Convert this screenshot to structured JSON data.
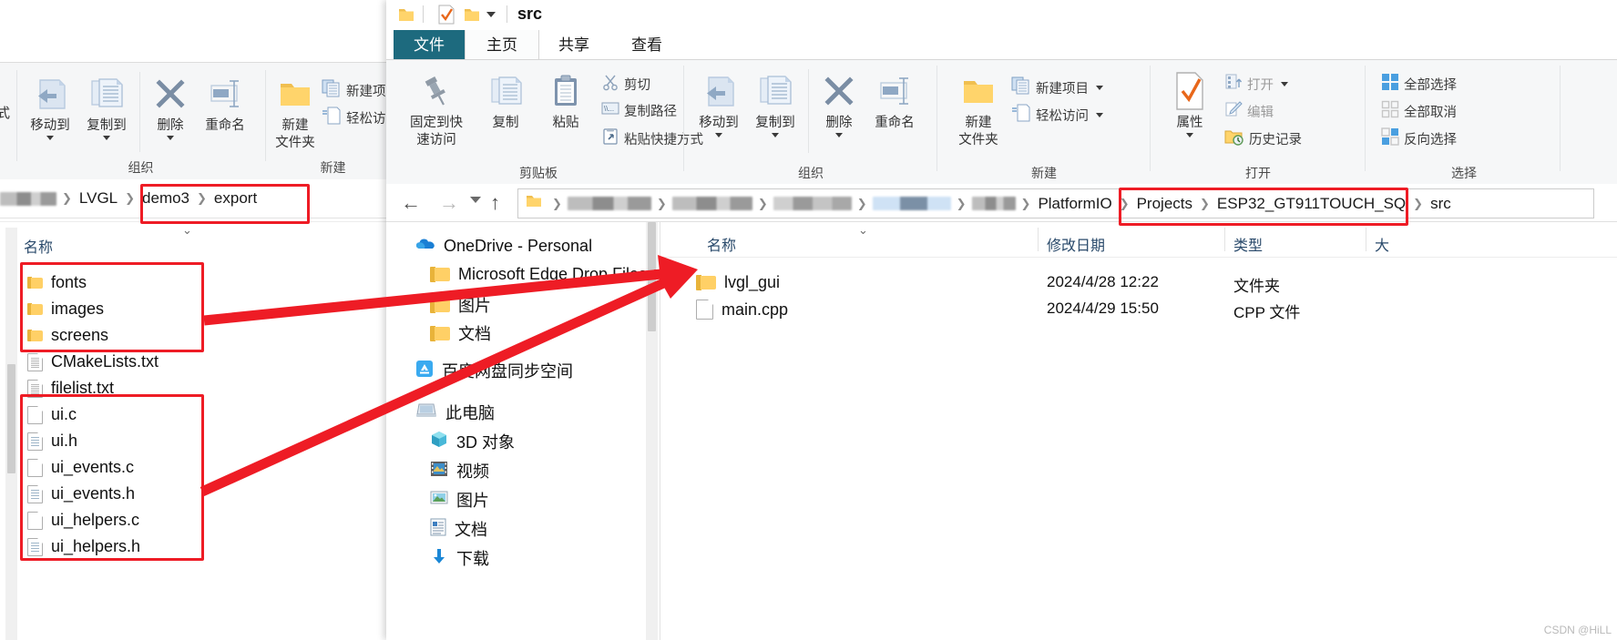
{
  "left_window": {
    "ribbon": {
      "groups": [
        {
          "label": "组织",
          "buttons": [
            {
              "label": "移动到",
              "icon": "move-to-icon",
              "has_dropdown": true
            },
            {
              "label": "复制到",
              "icon": "copy-to-icon",
              "has_dropdown": true
            },
            {
              "label": "删除",
              "icon": "delete-x-icon",
              "has_dropdown": true
            },
            {
              "label": "重命名",
              "icon": "rename-icon",
              "has_dropdown": false
            }
          ]
        },
        {
          "label": "新建",
          "buttons": [
            {
              "label": "新建\n文件夹",
              "line1": "新建",
              "line2": "文件夹",
              "icon": "new-folder-icon"
            }
          ],
          "small_buttons": [
            {
              "label": "新建项目",
              "icon": "new-item-icon",
              "has_dropdown": true
            },
            {
              "label": "轻松访问",
              "icon": "easy-access-icon",
              "has_dropdown": true
            }
          ]
        }
      ],
      "partial_left_label": "式"
    },
    "breadcrumb": {
      "redacted_prefix": true,
      "items": [
        "LVGL",
        "demo3",
        "export"
      ],
      "highlighted_from": 1
    },
    "column_header": "名称",
    "files": [
      {
        "name": "fonts",
        "icon": "folder-icon",
        "type": "folder"
      },
      {
        "name": "images",
        "icon": "folder-icon",
        "type": "folder"
      },
      {
        "name": "screens",
        "icon": "folder-icon",
        "type": "folder"
      },
      {
        "name": "CMakeLists.txt",
        "icon": "text-file-icon",
        "type": "file"
      },
      {
        "name": "filelist.txt",
        "icon": "text-file-icon",
        "type": "file"
      },
      {
        "name": "ui.c",
        "icon": "c-file-icon",
        "type": "file"
      },
      {
        "name": "ui.h",
        "icon": "h-file-icon",
        "type": "file"
      },
      {
        "name": "ui_events.c",
        "icon": "c-file-icon",
        "type": "file"
      },
      {
        "name": "ui_events.h",
        "icon": "h-file-icon",
        "type": "file"
      },
      {
        "name": "ui_helpers.c",
        "icon": "c-file-icon",
        "type": "file"
      },
      {
        "name": "ui_helpers.h",
        "icon": "h-file-icon",
        "type": "file"
      }
    ]
  },
  "right_window": {
    "title": "src",
    "titlebar_icons": [
      "folder-icon",
      "properties-check-icon",
      "new-folder-icon",
      "quick-access-dropdown-icon"
    ],
    "tabs": [
      {
        "label": "文件",
        "state": "file-menu"
      },
      {
        "label": "主页",
        "state": "active"
      },
      {
        "label": "共享",
        "state": "normal"
      },
      {
        "label": "查看",
        "state": "normal"
      }
    ],
    "ribbon": {
      "groups": [
        {
          "label": "剪贴板",
          "big_buttons": [
            {
              "label_line1": "固定到快",
              "label_line2": "速访问",
              "icon": "pin-icon"
            },
            {
              "label": "复制",
              "icon": "copy-icon"
            },
            {
              "label": "粘贴",
              "icon": "paste-icon",
              "has_dropdown": false
            }
          ],
          "small_buttons": [
            {
              "label": "剪切",
              "icon": "scissors-icon"
            },
            {
              "label": "复制路径",
              "icon": "copy-path-icon"
            },
            {
              "label": "粘贴快捷方式",
              "icon": "paste-shortcut-icon"
            }
          ]
        },
        {
          "label": "组织",
          "big_buttons": [
            {
              "label": "移动到",
              "icon": "move-to-icon",
              "has_dropdown": true
            },
            {
              "label": "复制到",
              "icon": "copy-to-icon",
              "has_dropdown": true
            },
            {
              "label": "删除",
              "icon": "delete-x-icon",
              "has_dropdown": true
            },
            {
              "label": "重命名",
              "icon": "rename-icon",
              "has_dropdown": false
            }
          ]
        },
        {
          "label": "新建",
          "big_buttons": [
            {
              "label_line1": "新建",
              "label_line2": "文件夹",
              "icon": "new-folder-icon"
            }
          ],
          "small_buttons": [
            {
              "label": "新建项目",
              "icon": "new-item-icon",
              "has_dropdown": true
            },
            {
              "label": "轻松访问",
              "icon": "easy-access-icon",
              "has_dropdown": true
            }
          ]
        },
        {
          "label": "打开",
          "big_buttons": [
            {
              "label": "属性",
              "icon": "properties-check-icon",
              "has_dropdown": true
            }
          ],
          "small_buttons": [
            {
              "label": "打开",
              "icon": "open-icon",
              "has_dropdown": true
            },
            {
              "label": "编辑",
              "icon": "edit-pencil-icon"
            },
            {
              "label": "历史记录",
              "icon": "history-icon"
            }
          ]
        },
        {
          "label": "选择",
          "small_buttons": [
            {
              "label": "全部选择",
              "icon": "select-all-icon"
            },
            {
              "label": "全部取消",
              "icon": "select-none-icon"
            },
            {
              "label": "反向选择",
              "icon": "invert-selection-icon"
            }
          ]
        }
      ]
    },
    "navigation": {
      "back_icon": "back-arrow-icon",
      "forward_icon": "forward-arrow-icon",
      "recent_icon": "chevron-down-icon",
      "up_icon": "up-arrow-icon"
    },
    "breadcrumb": {
      "redacted_segments": 4,
      "items": [
        "PlatformIO",
        "Projects",
        "ESP32_GT911TOUCH_SQ",
        "src"
      ],
      "highlighted": "ESP32_GT911TOUCH_SQ"
    },
    "nav_pane": [
      {
        "label": "OneDrive - Personal",
        "icon": "onedrive-cloud-icon",
        "indent": 0
      },
      {
        "label": "Microsoft Edge Drop Files",
        "icon": "folder-icon",
        "indent": 1
      },
      {
        "label": "图片",
        "icon": "folder-icon",
        "indent": 1
      },
      {
        "label": "文档",
        "icon": "folder-icon",
        "indent": 1
      },
      {
        "label": "百度网盘同步空间",
        "icon": "baidu-netdisk-icon",
        "indent": 0
      },
      {
        "label": "此电脑",
        "icon": "this-pc-icon",
        "indent": 0
      },
      {
        "label": "3D 对象",
        "icon": "3d-objects-icon",
        "indent": 1
      },
      {
        "label": "视频",
        "icon": "videos-icon",
        "indent": 1
      },
      {
        "label": "图片",
        "icon": "pictures-icon",
        "indent": 1
      },
      {
        "label": "文档",
        "icon": "documents-icon",
        "indent": 1
      },
      {
        "label": "下载",
        "icon": "downloads-icon",
        "indent": 1
      }
    ],
    "columns": [
      "名称",
      "修改日期",
      "类型",
      "大"
    ],
    "files": [
      {
        "name": "lvgl_gui",
        "icon": "folder-icon",
        "modified": "2024/4/28 12:22",
        "type": "文件夹"
      },
      {
        "name": "main.cpp",
        "icon": "cpp-file-icon",
        "modified": "2024/4/29 15:50",
        "type": "CPP 文件"
      }
    ]
  },
  "annotations": {
    "color": "#ee1c25",
    "boxes": [
      {
        "name": "left-breadcrumb-highlight"
      },
      {
        "name": "left-folders-highlight"
      },
      {
        "name": "left-ui-files-highlight"
      },
      {
        "name": "right-breadcrumb-highlight"
      }
    ],
    "arrows": [
      {
        "name": "folders-to-lvgl-gui-arrow"
      },
      {
        "name": "ui-files-to-lvgl-gui-arrow"
      }
    ]
  },
  "watermark": "CSDN @HiLL"
}
